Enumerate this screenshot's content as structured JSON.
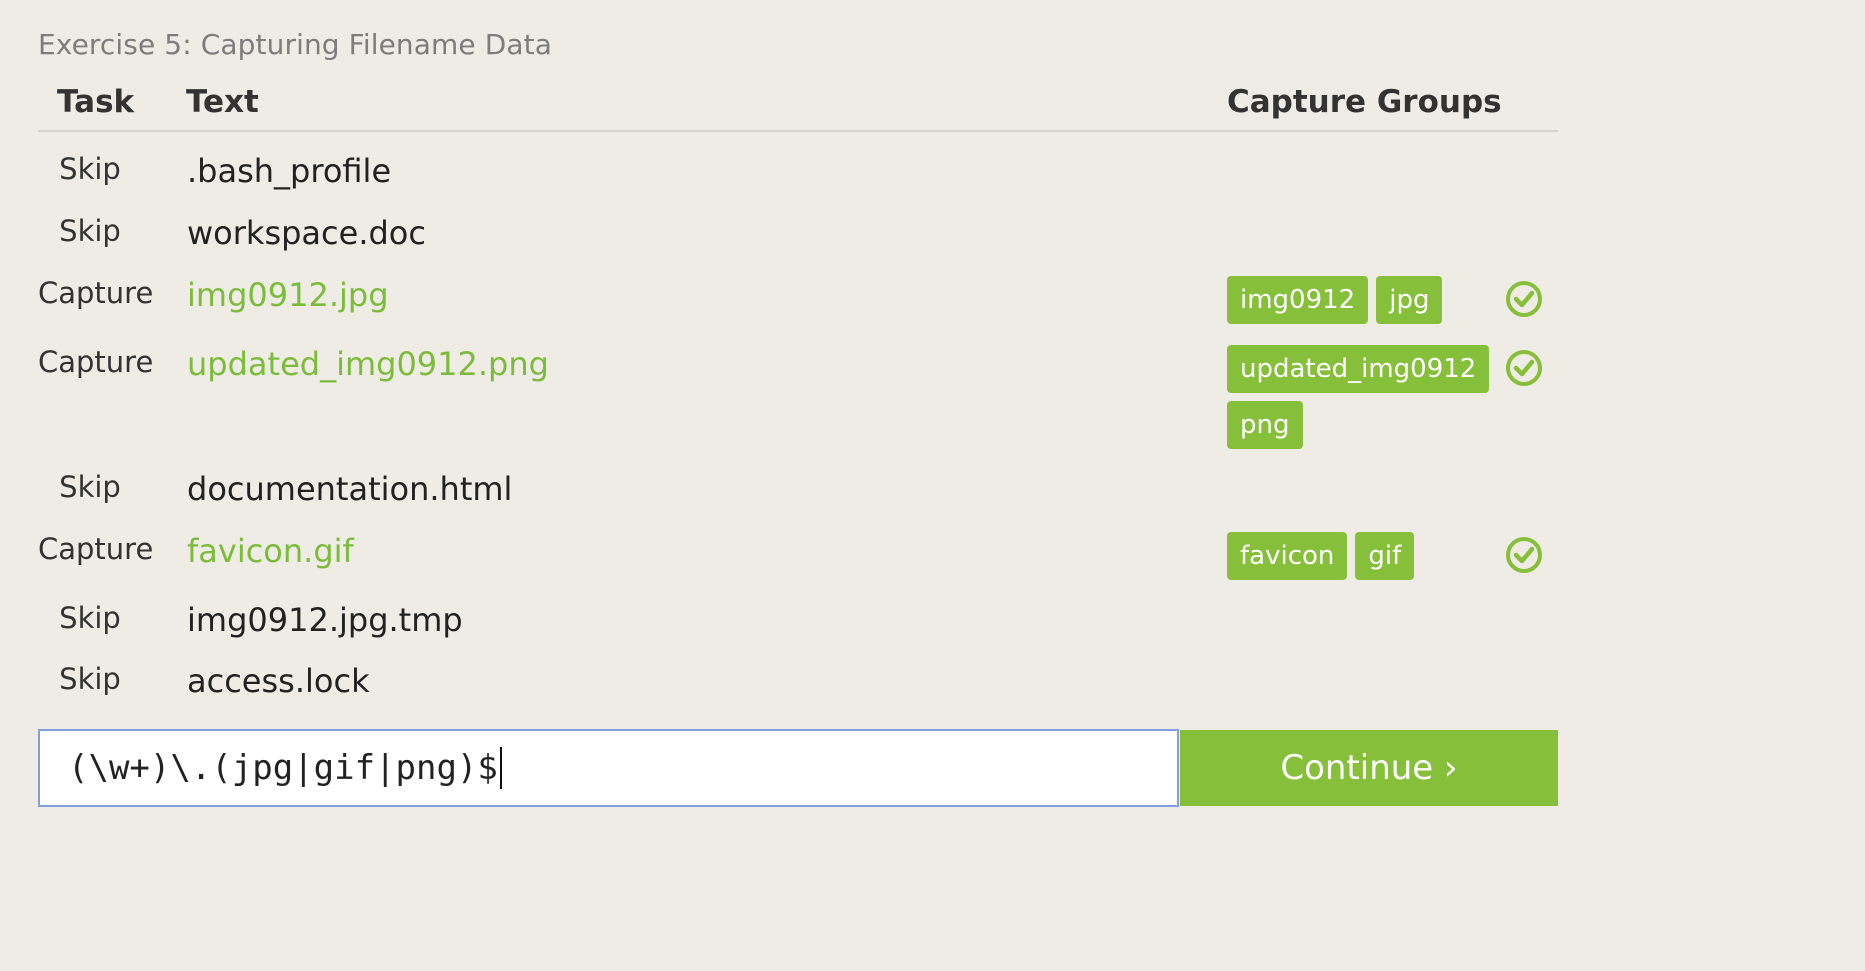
{
  "exercise": {
    "title": "Exercise 5: Capturing Filename Data"
  },
  "table": {
    "headers": {
      "task": "Task",
      "text": "Text",
      "groups": "Capture Groups"
    },
    "rows": [
      {
        "task": "Skip",
        "text": ".bash_profile",
        "groups": [],
        "status": ""
      },
      {
        "task": "Skip",
        "text": "workspace.doc",
        "groups": [],
        "status": ""
      },
      {
        "task": "Capture",
        "text": "img0912.jpg",
        "groups": [
          "img0912",
          "jpg"
        ],
        "status": "check-circle-icon"
      },
      {
        "task": "Capture",
        "text": "updated_img0912.png",
        "groups": [
          "updated_img0912",
          "png"
        ],
        "status": "check-circle-icon"
      },
      {
        "task": "Skip",
        "text": "documentation.html",
        "groups": [],
        "status": ""
      },
      {
        "task": "Capture",
        "text": "favicon.gif",
        "groups": [
          "favicon",
          "gif"
        ],
        "status": "check-circle-icon"
      },
      {
        "task": "Skip",
        "text": "img0912.jpg.tmp",
        "groups": [],
        "status": ""
      },
      {
        "task": "Skip",
        "text": "access.lock",
        "groups": [],
        "status": ""
      }
    ]
  },
  "answer": {
    "value": "(\\w+)\\.(jpg|gif|png)$"
  },
  "actions": {
    "continue_label": "Continue ›"
  },
  "colors": {
    "accent": "#86c03b",
    "match_text": "#7bbd3a",
    "background": "#efece6"
  }
}
